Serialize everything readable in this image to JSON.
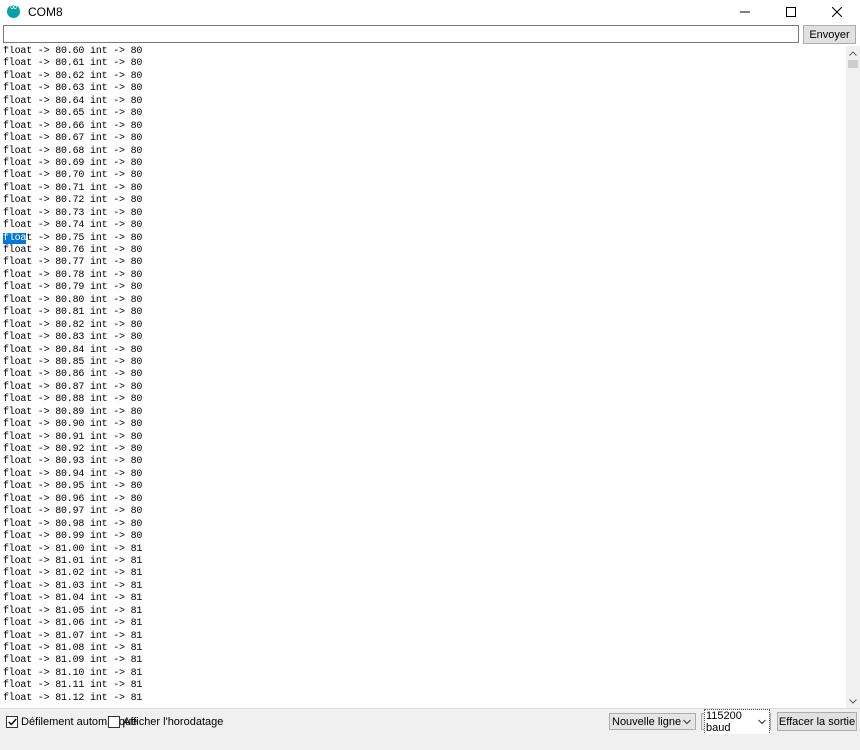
{
  "window": {
    "title": "COM8",
    "minimize_icon": "minimize-icon",
    "maximize_icon": "maximize-icon",
    "close_icon": "close-icon"
  },
  "send": {
    "input_value": "",
    "button_label": "Envoyer"
  },
  "output": {
    "selected_fragment": "floa",
    "lines": [
      "float -> 80.60 int -> 80",
      "float -> 80.61 int -> 80",
      "float -> 80.62 int -> 80",
      "float -> 80.63 int -> 80",
      "float -> 80.64 int -> 80",
      "float -> 80.65 int -> 80",
      "float -> 80.66 int -> 80",
      "float -> 80.67 int -> 80",
      "float -> 80.68 int -> 80",
      "float -> 80.69 int -> 80",
      "float -> 80.70 int -> 80",
      "float -> 80.71 int -> 80",
      "float -> 80.72 int -> 80",
      "float -> 80.73 int -> 80",
      "float -> 80.74 int -> 80",
      "float -> 80.75 int -> 80",
      "float -> 80.76 int -> 80",
      "float -> 80.77 int -> 80",
      "float -> 80.78 int -> 80",
      "float -> 80.79 int -> 80",
      "float -> 80.80 int -> 80",
      "float -> 80.81 int -> 80",
      "float -> 80.82 int -> 80",
      "float -> 80.83 int -> 80",
      "float -> 80.84 int -> 80",
      "float -> 80.85 int -> 80",
      "float -> 80.86 int -> 80",
      "float -> 80.87 int -> 80",
      "float -> 80.88 int -> 80",
      "float -> 80.89 int -> 80",
      "float -> 80.90 int -> 80",
      "float -> 80.91 int -> 80",
      "float -> 80.92 int -> 80",
      "float -> 80.93 int -> 80",
      "float -> 80.94 int -> 80",
      "float -> 80.95 int -> 80",
      "float -> 80.96 int -> 80",
      "float -> 80.97 int -> 80",
      "float -> 80.98 int -> 80",
      "float -> 80.99 int -> 80",
      "float -> 81.00 int -> 81",
      "float -> 81.01 int -> 81",
      "float -> 81.02 int -> 81",
      "float -> 81.03 int -> 81",
      "float -> 81.04 int -> 81",
      "float -> 81.05 int -> 81",
      "float -> 81.06 int -> 81",
      "float -> 81.07 int -> 81",
      "float -> 81.08 int -> 81",
      "float -> 81.09 int -> 81",
      "float -> 81.10 int -> 81",
      "float -> 81.11 int -> 81",
      "float -> 81.12 int -> 81"
    ]
  },
  "status": {
    "autoscroll_label": "Défilement automatique",
    "autoscroll_checked": true,
    "timestamp_label": "Afficher l'horodatage",
    "timestamp_checked": false,
    "line_ending": "Nouvelle ligne",
    "baud": "115200 baud",
    "clear_label": "Effacer la sortie"
  },
  "colors": {
    "selection": "#0078d7",
    "app_icon": "#0aa0a8"
  }
}
